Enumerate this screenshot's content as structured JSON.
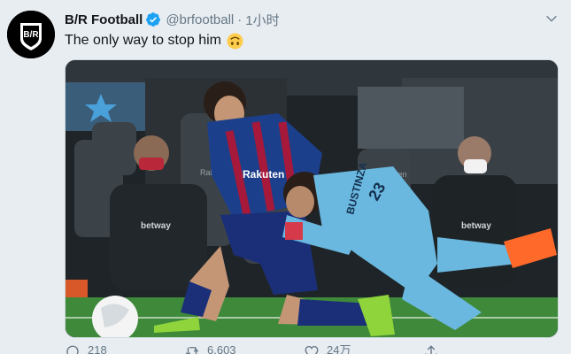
{
  "tweet": {
    "display_name": "B/R Football",
    "handle": "@brfootball",
    "separator": "·",
    "time": "1小时",
    "text": "The only way to stop him",
    "emoji": "upside-down-face",
    "avatar_text": "B/R",
    "verified": true
  },
  "media": {
    "sponsor_text": "Rakuten",
    "shirt_sponsor": "Rakuten",
    "player_name_on_shirt": "BUSTINZA",
    "player_number": "23",
    "bench_sponsor": "betway"
  },
  "actions": {
    "reply_count": "218",
    "retweet_count": "6,603",
    "like_count": "24万",
    "share_label": ""
  },
  "colors": {
    "verified": "#1da1f2",
    "text_secondary": "#657786",
    "background": "#e8edf1"
  }
}
